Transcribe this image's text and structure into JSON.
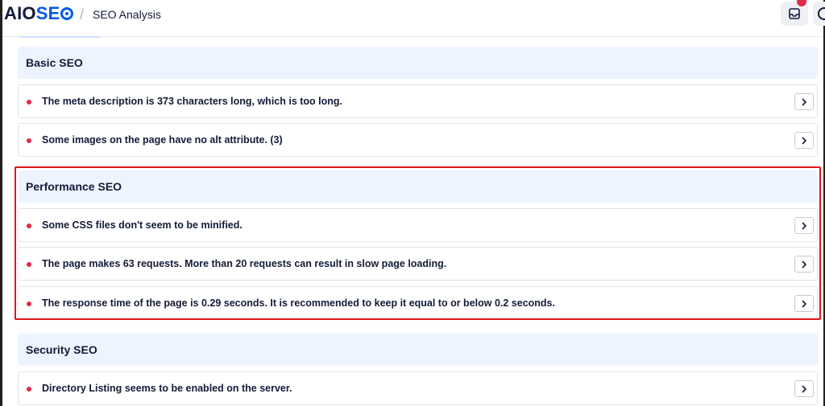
{
  "header": {
    "logo_prefix": "AIO",
    "logo_suffix": "SE",
    "breadcrumb_separator": "/",
    "page_title": "SEO Analysis"
  },
  "icons": {
    "notifications": "inbox-icon",
    "help": "help-circle-icon",
    "row_action": "chevron-right-icon"
  },
  "colors": {
    "brand_blue": "#005ae0",
    "error_red": "#df2a4a",
    "section_bg": "#eef4ff",
    "highlight": "#e3151a"
  },
  "sections": [
    {
      "title": "Basic SEO",
      "items": [
        "The meta description is 373 characters long, which is too long.",
        "Some images on the page have no alt attribute. (3)"
      ]
    },
    {
      "title": "Performance SEO",
      "items": [
        "Some CSS files don't seem to be minified.",
        "The page makes 63 requests. More than 20 requests can result in slow page loading.",
        "The response time of the page is 0.29 seconds. It is recommended to keep it equal to or below 0.2 seconds."
      ]
    },
    {
      "title": "Security SEO",
      "items": [
        "Directory Listing seems to be enabled on the server."
      ]
    }
  ]
}
